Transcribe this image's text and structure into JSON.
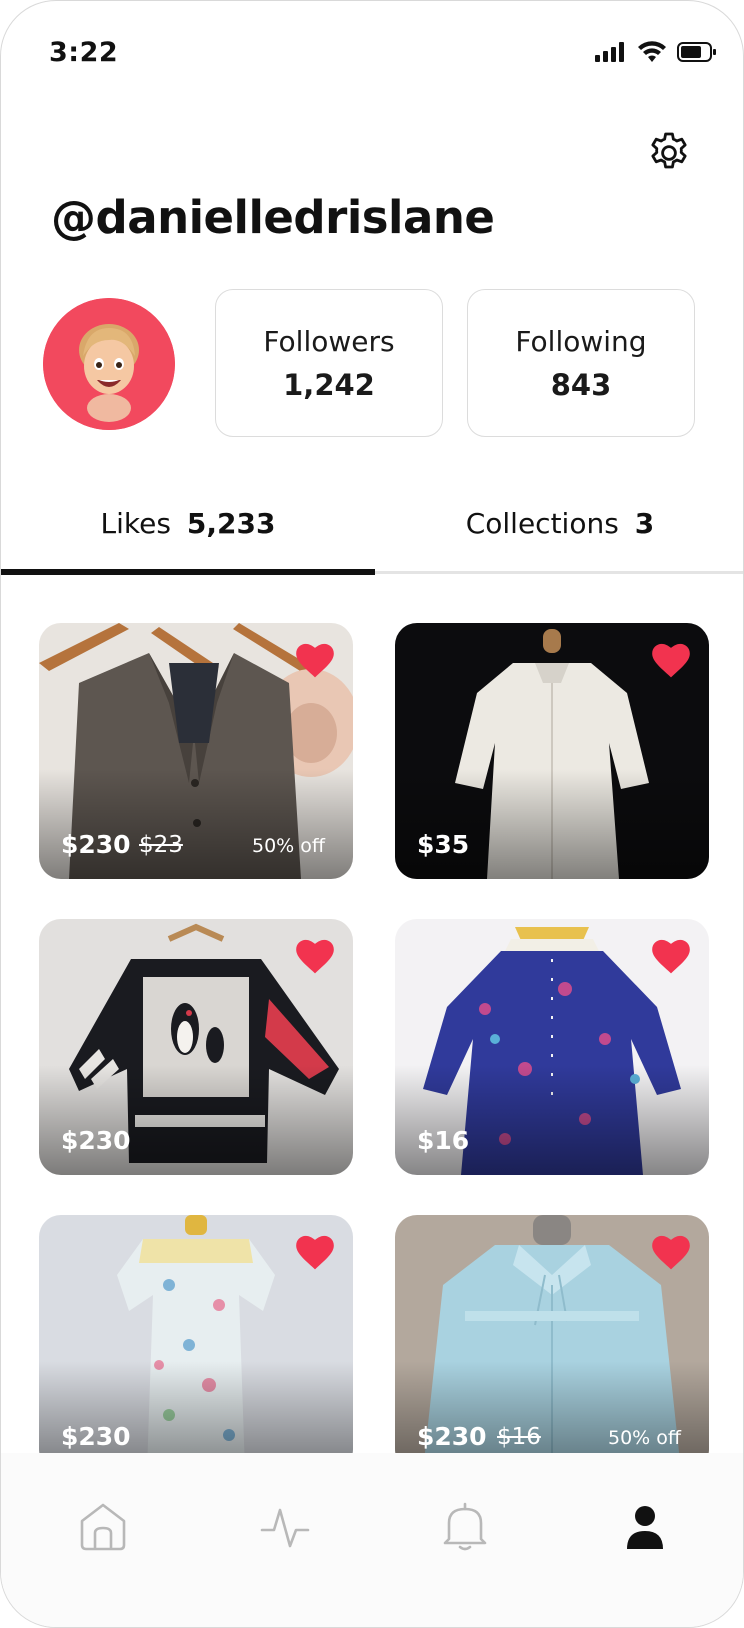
{
  "status_bar": {
    "time": "3:22"
  },
  "profile": {
    "username": "@danielledrislane",
    "followers_label": "Followers",
    "followers_count": "1,242",
    "following_label": "Following",
    "following_count": "843"
  },
  "tabs": {
    "likes_label": "Likes",
    "likes_count": "5,233",
    "collections_label": "Collections",
    "collections_count": "3",
    "active": "likes"
  },
  "items": [
    {
      "name": "tweed blazer",
      "price": "$230",
      "old_price": "$23",
      "discount": "50% off",
      "liked": true
    },
    {
      "name": "white tunic",
      "price": "$35",
      "old_price": "",
      "discount": "",
      "liked": true
    },
    {
      "name": "penguin sweater",
      "price": "$230",
      "old_price": "",
      "discount": "",
      "liked": true
    },
    {
      "name": "blue floral dress",
      "price": "$16",
      "old_price": "",
      "discount": "",
      "liked": true
    },
    {
      "name": "floral dress",
      "price": "$230",
      "old_price": "",
      "discount": "",
      "liked": true
    },
    {
      "name": "light blue robe",
      "price": "$230",
      "old_price": "$16",
      "discount": "50% off",
      "liked": true
    }
  ],
  "nav": {
    "items": [
      "home-icon",
      "activity-icon",
      "bell-icon",
      "profile-icon"
    ],
    "active": "profile-icon"
  },
  "colors": {
    "accent": "#f2334f",
    "avatar_bg": "#f2495e",
    "text": "#111111"
  }
}
